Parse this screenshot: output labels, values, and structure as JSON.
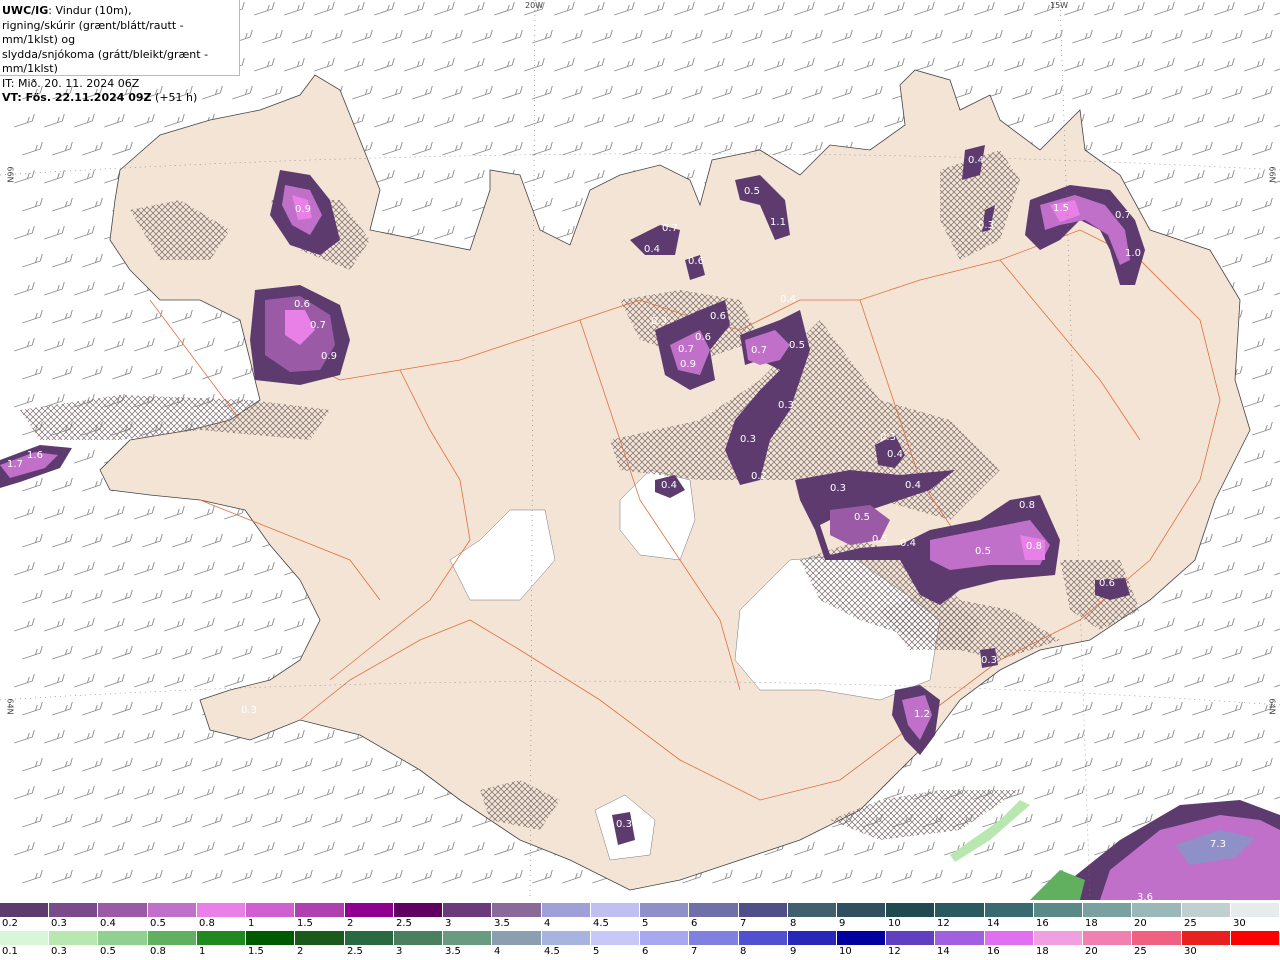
{
  "title_box": {
    "line1_bold": "UWC/IG",
    "line1_rest": ": Vindur (10m),",
    "line2": "rigning/skúrir (grænt/blátt/rautt - mm/1klst) og",
    "line3": "slydda/snjókoma (grátt/bleikt/grænt - mm/1klst)",
    "line4": "IT: Mið. 20. 11. 2024 06Z",
    "line5_bold": "VT: Fös. 22.11.2024 09Z",
    "line5_rest": " (+51 h)"
  },
  "graticule": {
    "lon_top": [
      "20W",
      "15W"
    ],
    "lat_left": [
      "66N",
      "64N"
    ],
    "lat_right": [
      "66N",
      "64N"
    ]
  },
  "precip_labels": [
    {
      "t": "0.9"
    },
    {
      "t": "0.6"
    },
    {
      "t": "0.7"
    },
    {
      "t": "0.9"
    },
    {
      "t": "1.7"
    },
    {
      "t": "1.6"
    },
    {
      "t": "0.7"
    },
    {
      "t": "0.4"
    },
    {
      "t": "0.6"
    },
    {
      "t": "0.3"
    },
    {
      "t": "0.6"
    },
    {
      "t": "0.6"
    },
    {
      "t": "0.7"
    },
    {
      "t": "0.9"
    },
    {
      "t": "0.5"
    },
    {
      "t": "1.1"
    },
    {
      "t": "0.4"
    },
    {
      "t": "0.7"
    },
    {
      "t": "0.5"
    },
    {
      "t": "0.3"
    },
    {
      "t": "0.3"
    },
    {
      "t": "0.2"
    },
    {
      "t": "0.4"
    },
    {
      "t": "0.3"
    },
    {
      "t": "0.3"
    },
    {
      "t": "0.4"
    },
    {
      "t": "0.4"
    },
    {
      "t": "0.5"
    },
    {
      "t": "0.5"
    },
    {
      "t": "0.4"
    },
    {
      "t": "0.8"
    },
    {
      "t": "0.5"
    },
    {
      "t": "0.8"
    },
    {
      "t": "0.6"
    },
    {
      "t": "0.4"
    },
    {
      "t": "0.3"
    },
    {
      "t": "1.5"
    },
    {
      "t": "0.7"
    },
    {
      "t": "1.0"
    },
    {
      "t": "0.3"
    },
    {
      "t": "0.3"
    },
    {
      "t": "1.2"
    },
    {
      "t": "0.3"
    },
    {
      "t": "0.3"
    },
    {
      "t": "7.3"
    },
    {
      "t": "3.6"
    }
  ],
  "legend_snow": {
    "labels": [
      "0.2",
      "0.3",
      "0.4",
      "0.5",
      "0.8",
      "1",
      "1.5",
      "2",
      "2.5",
      "3",
      "3.5",
      "4",
      "4.5",
      "5",
      "6",
      "7",
      "8",
      "9",
      "10",
      "12",
      "14",
      "16",
      "18",
      "20",
      "25",
      "30"
    ],
    "colors": [
      "#5e3b6e",
      "#7a4a8a",
      "#9a5aa6",
      "#c070c8",
      "#e880e8",
      "#d060d0",
      "#b040b0",
      "#900090",
      "#600060",
      "#6a3a7a",
      "#8a6a9a",
      "#a0a0d8",
      "#c0c0f0",
      "#9090c8",
      "#7070a8",
      "#505088",
      "#406070",
      "#305060",
      "#204a50",
      "#2a5a60",
      "#3a6a70",
      "#5a8a88",
      "#7aa0a0",
      "#9ab8b8",
      "#c0d0d0",
      "#e6ecec"
    ]
  },
  "legend_rain": {
    "labels": [
      "0.1",
      "0.3",
      "0.5",
      "0.8",
      "1",
      "1.5",
      "2",
      "2.5",
      "3",
      "3.5",
      "4",
      "4.5",
      "5",
      "6",
      "7",
      "8",
      "9",
      "10",
      "12",
      "14",
      "16",
      "18",
      "20",
      "25",
      "30"
    ],
    "colors": [
      "#d8f6d8",
      "#b8e8b0",
      "#90d090",
      "#60b060",
      "#208a20",
      "#005a00",
      "#1a5a1a",
      "#2a6a40",
      "#4a8060",
      "#6a9a80",
      "#8aa0b0",
      "#a8b4e0",
      "#c8c8f8",
      "#a8a8f0",
      "#8080e0",
      "#5050d0",
      "#2828b8",
      "#0000a0",
      "#6040c0",
      "#a060e0",
      "#e070f0",
      "#f0a0e0",
      "#f080b0",
      "#f06080",
      "#e82020",
      "#ff0000"
    ]
  }
}
